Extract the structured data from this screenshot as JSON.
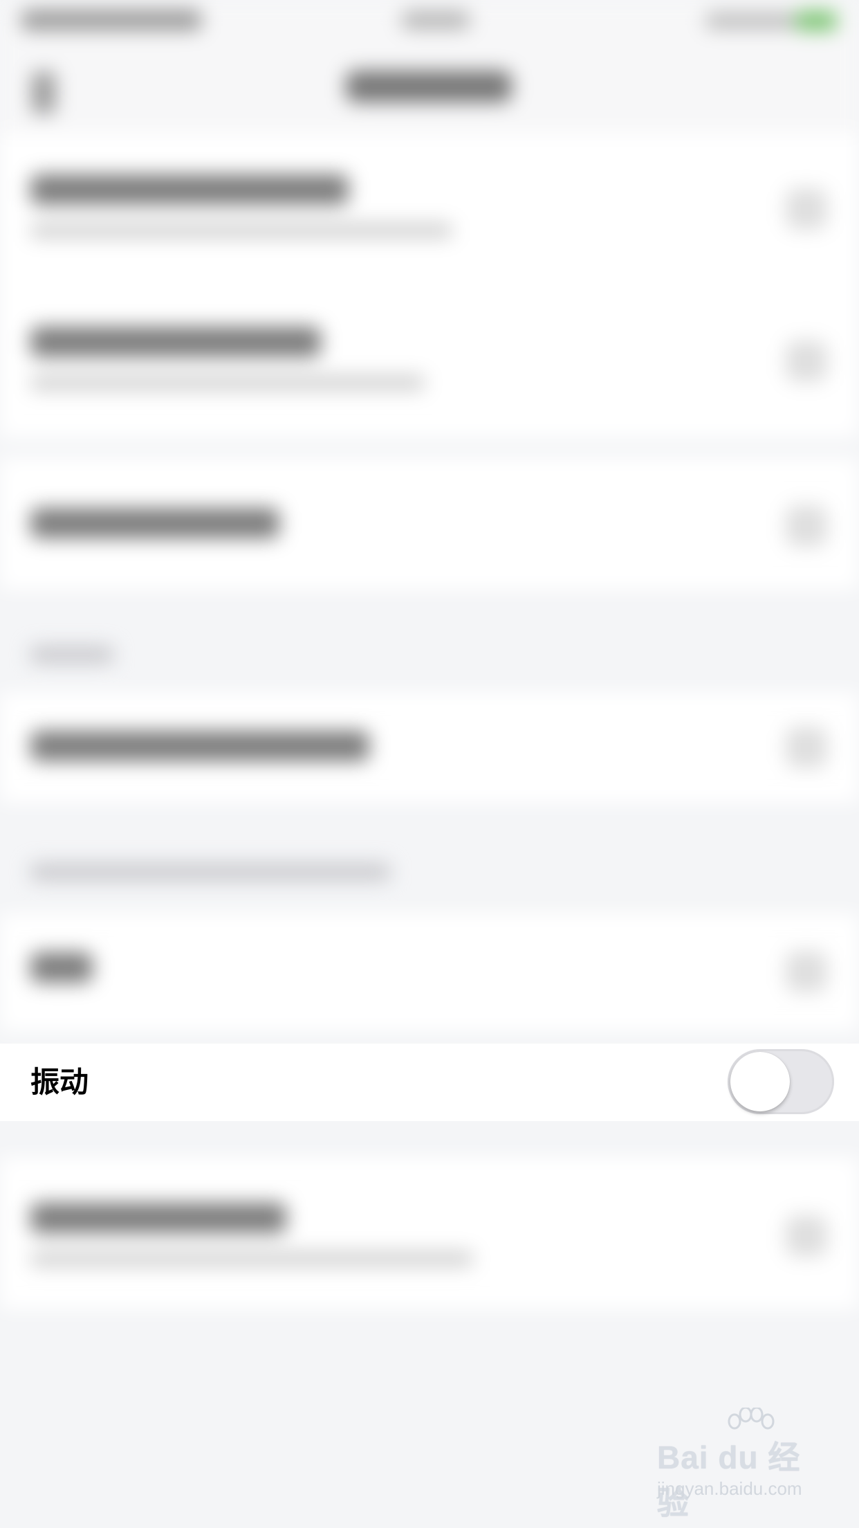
{
  "vibration_row": {
    "label": "振动",
    "toggle_on": false
  },
  "watermark": {
    "logo_text": "Bai du 经验",
    "url": "jingyan.baidu.com"
  },
  "colors": {
    "background": "#f4f5f7",
    "row_background": "#ffffff",
    "toggle_off_track": "#e6e6ea",
    "status_battery": "#78c36f"
  },
  "icons": [
    "back-arrow-icon",
    "chevron-right-icon",
    "battery-icon",
    "baidu-paw-icon"
  ]
}
